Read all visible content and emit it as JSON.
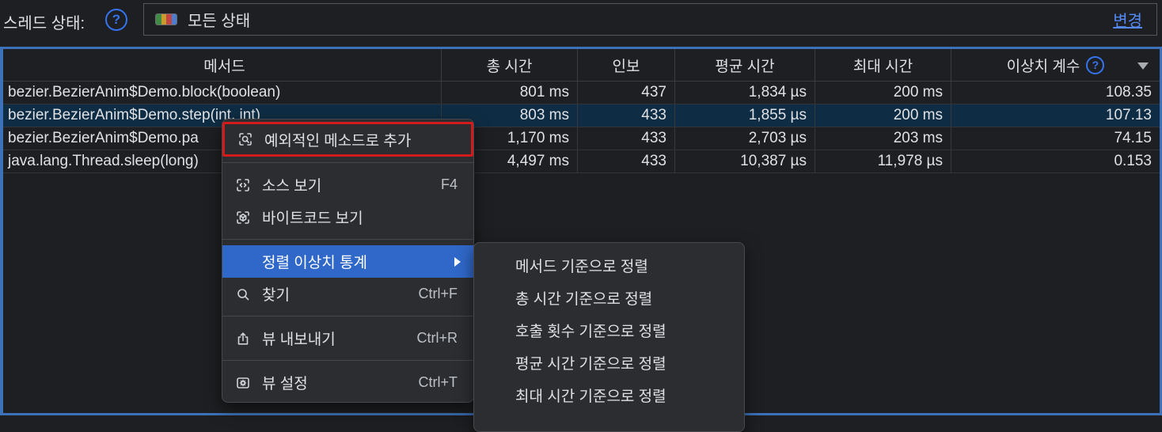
{
  "toolbar": {
    "label": "스레드 상태:",
    "help_glyph": "?",
    "filter": {
      "value": "모든 상태",
      "change_label": "변경",
      "swatch_colors": [
        "#3f8b46",
        "#c99a2e",
        "#c04543",
        "#4a7ed2"
      ]
    }
  },
  "table": {
    "columns": [
      "메서드",
      "총 시간",
      "인보",
      "평균 시간",
      "최대 시간",
      "이상치 계수"
    ],
    "sort": {
      "column": "이상치 계수",
      "direction": "desc"
    },
    "rows": [
      {
        "method": "bezier.BezierAnim$Demo.block(boolean)",
        "total": "801 ms",
        "invocations": "437",
        "avg": "1,834 µs",
        "max": "200 ms",
        "outlier": "108.35"
      },
      {
        "method": "bezier.BezierAnim$Demo.step(int, int)",
        "total": "803 ms",
        "invocations": "433",
        "avg": "1,855 µs",
        "max": "200 ms",
        "outlier": "107.13"
      },
      {
        "method": "bezier.BezierAnim$Demo.pa",
        "total": "1,170 ms",
        "invocations": "433",
        "avg": "2,703 µs",
        "max": "203 ms",
        "outlier": "74.15"
      },
      {
        "method": "java.lang.Thread.sleep(long)",
        "total": "4,497 ms",
        "invocations": "433",
        "avg": "10,387 µs",
        "max": "11,978 µs",
        "outlier": "0.153"
      }
    ],
    "selected_row_index": 1
  },
  "context_menu": {
    "items": [
      {
        "label": "예외적인 메소드로 추가",
        "icon": "add-exceptional-method-icon",
        "annotated_red": true
      },
      {
        "label": "소스 보기",
        "shortcut": "F4",
        "icon": "view-source-icon"
      },
      {
        "label": "바이트코드 보기",
        "icon": "view-bytecode-icon"
      },
      {
        "label": "정렬 이상치 통계",
        "has_submenu": true,
        "highlighted": true
      },
      {
        "label": "찾기",
        "shortcut": "Ctrl+F",
        "icon": "search-icon"
      },
      {
        "label": "뷰 내보내기",
        "shortcut": "Ctrl+R",
        "icon": "export-icon"
      },
      {
        "label": "뷰 설정",
        "shortcut": "Ctrl+T",
        "icon": "settings-icon"
      }
    ]
  },
  "submenu": {
    "items": [
      "메서드 기준으로 정렬",
      "총 시간 기준으로 정렬",
      "호출 횟수 기준으로 정렬",
      "평균 시간 기준으로 정렬",
      "최대 시간 기준으로 정렬"
    ]
  },
  "colors": {
    "table_focus_border": "#3d72b8",
    "selected_row": "#0e2d44",
    "menu_highlight": "#3068c9",
    "annotation_red": "#d21b1b",
    "link_blue": "#548af7",
    "help_icon_blue": "#3574f0",
    "menu_background": "#2b2d30",
    "background": "#1e1f22"
  }
}
